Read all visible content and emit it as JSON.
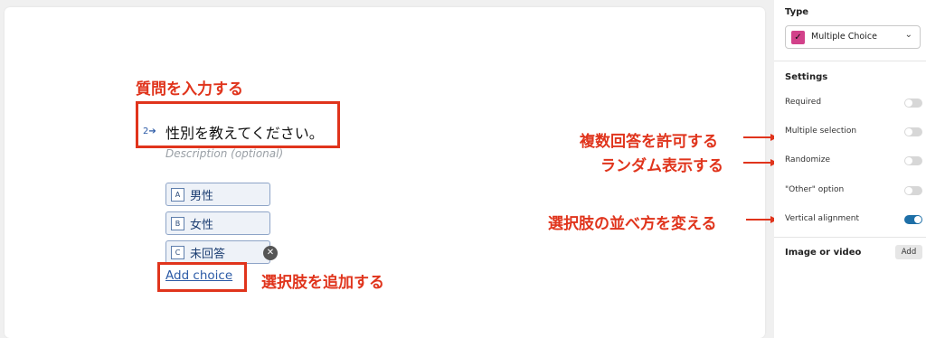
{
  "editor": {
    "question_number": "2",
    "question_text": "性別を教えてください。",
    "description_placeholder": "Description (optional)",
    "choices": [
      {
        "key": "A",
        "label": "男性"
      },
      {
        "key": "B",
        "label": "女性"
      },
      {
        "key": "C",
        "label": "未回答"
      }
    ],
    "add_choice_label": "Add choice"
  },
  "annotations": {
    "enter_question": "質問を入力する",
    "add_choice": "選択肢を追加する",
    "allow_multiple": "複数回答を許可する",
    "randomize": "ランダム表示する",
    "change_alignment": "選択肢の並べ方を変える"
  },
  "sidebar": {
    "type_heading": "Type",
    "type_value": "Multiple Choice",
    "type_icon": "checkbox-icon",
    "settings_heading": "Settings",
    "settings": [
      {
        "label": "Required",
        "on": false
      },
      {
        "label": "Multiple selection",
        "on": false
      },
      {
        "label": "Randomize",
        "on": false
      },
      {
        "label": "\"Other\" option",
        "on": false
      },
      {
        "label": "Vertical alignment",
        "on": true
      }
    ],
    "media_label": "Image or video",
    "media_button": "Add"
  },
  "colors": {
    "accent": "#1e6fa7",
    "annotation_red": "#e0341c",
    "type_badge": "#d2418a"
  }
}
